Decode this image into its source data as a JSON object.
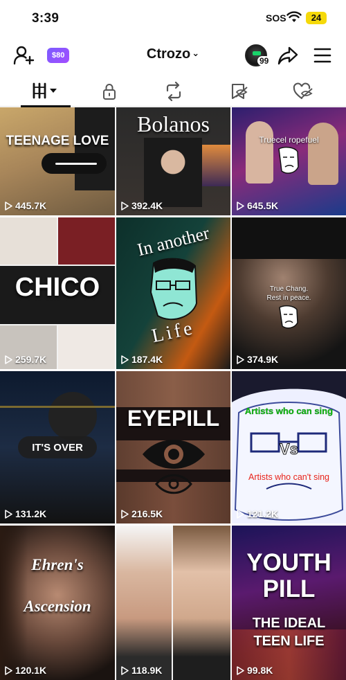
{
  "status": {
    "time": "3:39",
    "sos": "SOS",
    "battery": "24"
  },
  "header": {
    "coins": "$80",
    "username": "Ctrozo",
    "notif_count": "99"
  },
  "tabs": [
    "videos-tab",
    "private-tab",
    "reposts-tab",
    "favorites-tab",
    "liked-tab"
  ],
  "videos": [
    {
      "views": "445.7K",
      "overlay": "TEENAGE LOVE"
    },
    {
      "views": "392.4K",
      "overlay": "Bolanos"
    },
    {
      "views": "645.5K",
      "overlay": "Truecel ropefuel"
    },
    {
      "views": "259.7K",
      "overlay": "CHICO"
    },
    {
      "views": "187.4K",
      "overlay_top": "In another",
      "overlay_bottom": "Life"
    },
    {
      "views": "374.9K",
      "overlay_line1": "True Chang.",
      "overlay_line2": "Rest in peace."
    },
    {
      "views": "131.2K",
      "overlay": "IT'S OVER"
    },
    {
      "views": "216.5K",
      "overlay": "EYEPILL"
    },
    {
      "views": "121.2K",
      "overlay_top": "Artists who can sing",
      "overlay_mid": "Vs",
      "overlay_bottom": "Artists who can't sing"
    },
    {
      "views": "120.1K",
      "overlay_line1": "Ehren's",
      "overlay_line2": "Ascension"
    },
    {
      "views": "118.9K"
    },
    {
      "views": "99.8K",
      "overlay_line1": "YOUTH",
      "overlay_line2": "PILL",
      "overlay_line3": "THE IDEAL",
      "overlay_line4": "TEEN LIFE"
    }
  ],
  "colors": {
    "accent": "#7b5cff",
    "battery": "#f5d90a",
    "artists_can": "#16c60c",
    "artists_cant": "#e8231a"
  }
}
